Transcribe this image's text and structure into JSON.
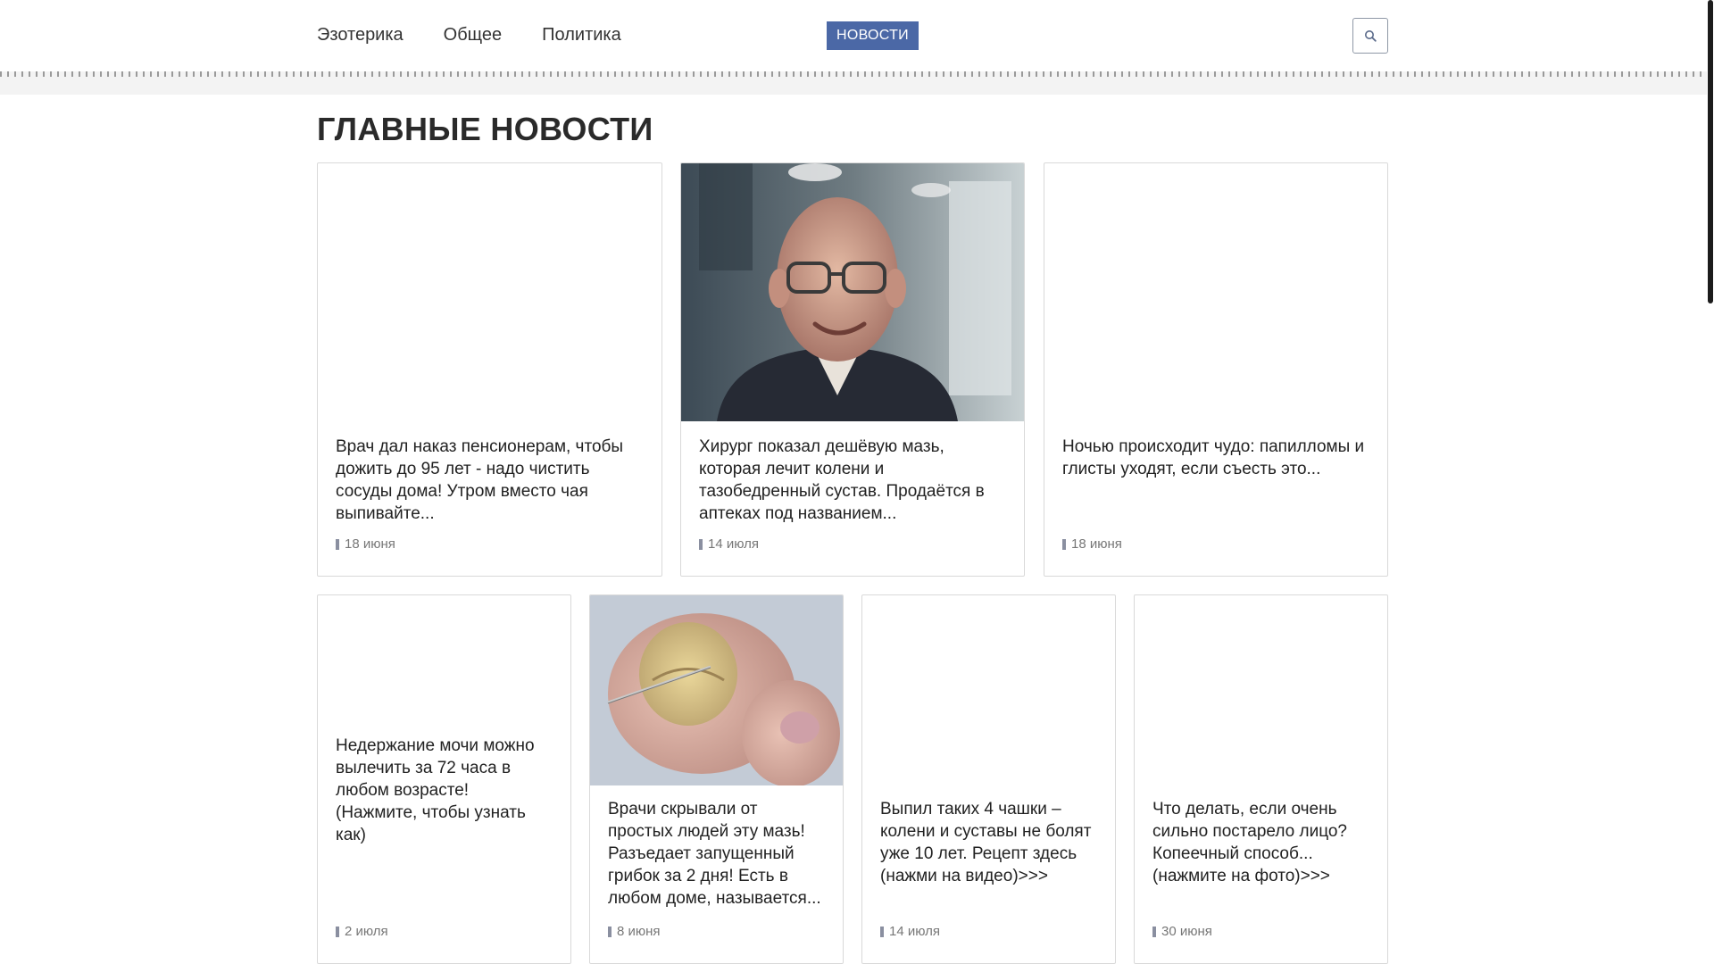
{
  "nav": {
    "items": [
      "Эзотерика",
      "Общее",
      "Политика"
    ],
    "news_badge": "НОВОСТИ"
  },
  "page": {
    "title": "ГЛАВНЫЕ НОВОСТИ"
  },
  "cards_row1": [
    {
      "title": "Врач дал наказ пенсионерам, чтобы дожить до 95 лет - надо чистить сосуды дома! Утром вместо чая выпивайте...",
      "date": "18 июня",
      "image": "none"
    },
    {
      "title": "Хирург показал дешёвую мазь, которая лечит колени и тазобедренный сустав. Продаётся в аптеках под названием...",
      "date": "14 июля",
      "image": "elderly-man-photo"
    },
    {
      "title": "Ночью происходит чудо: папилломы и глисты уходят, если съесть это...",
      "date": "18 июня",
      "image": "none"
    }
  ],
  "cards_row2": [
    {
      "title": "Недержание мочи можно вылечить за 72 часа в любом возрасте! (Нажмите, чтобы узнать как)",
      "date": "2 июля",
      "image": "none"
    },
    {
      "title": "Врачи скрывали от простых людей эту мазь! Разъедает запущенный грибок за 2 дня! Есть в любом доме, называется...",
      "date": "8 июня",
      "image": "toenail-photo"
    },
    {
      "title": "Выпил таких 4 чашки – колени и суставы не болят уже 10 лет. Рецепт здесь (нажми на видео)>>>",
      "date": "14 июля",
      "image": "none"
    },
    {
      "title": "Что делать, если очень сильно постарело лицо? Копеечный способ... (нажмите на фото)>>>",
      "date": "30 июня",
      "image": "none"
    }
  ],
  "colors": {
    "accent": "#4b68a6",
    "text": "#222222",
    "muted": "#777777",
    "border": "#d9d9d9"
  },
  "icons": {
    "search": "search-icon",
    "date": "clock-icon"
  }
}
